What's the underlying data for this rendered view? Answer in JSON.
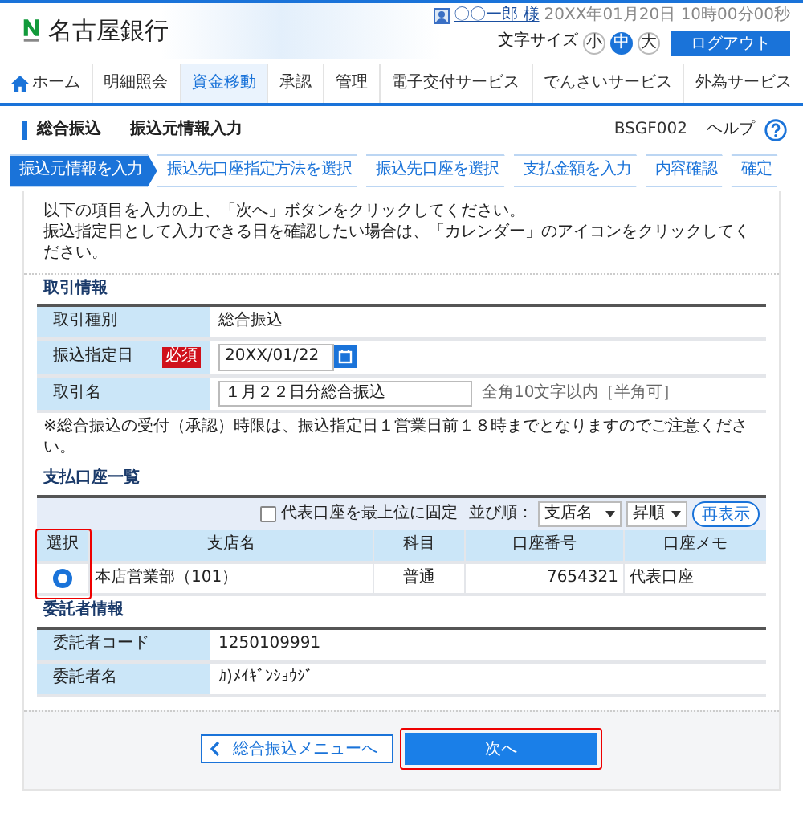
{
  "header": {
    "bank_name": "名古屋銀行",
    "user_name": "〇〇一郎 様",
    "datetime": "20XX年01月20日 10時00分00秒",
    "font_size_label": "文字サイズ",
    "font_sizes": [
      {
        "label": "小",
        "selected": false
      },
      {
        "label": "中",
        "selected": true
      },
      {
        "label": "大",
        "selected": false
      }
    ],
    "logout": "ログアウト"
  },
  "nav": [
    {
      "label": "ホーム",
      "kind": "home",
      "selected": false
    },
    {
      "label": "明細照会",
      "kind": "text",
      "selected": false
    },
    {
      "label": "資金移動",
      "kind": "text",
      "selected": true
    },
    {
      "label": "承認",
      "kind": "text",
      "selected": false
    },
    {
      "label": "管理",
      "kind": "text",
      "selected": false
    },
    {
      "label": "電子交付サービス",
      "kind": "text",
      "selected": false
    },
    {
      "label": "でんさいサービス",
      "kind": "text",
      "selected": false
    },
    {
      "label": "外為サービス",
      "kind": "text",
      "selected": false
    }
  ],
  "page": {
    "category": "総合振込",
    "title": "振込元情報入力",
    "screen_id": "BSGF002",
    "help": "ヘルプ"
  },
  "steps": [
    {
      "label": "振込元情報を入力",
      "selected": true
    },
    {
      "label": "振込先口座指定方法を選択",
      "selected": false
    },
    {
      "label": "振込先口座を選択",
      "selected": false
    },
    {
      "label": "支払金額を入力",
      "selected": false
    },
    {
      "label": "内容確認",
      "selected": false
    },
    {
      "label": "確定",
      "selected": false
    }
  ],
  "instructions": [
    "以下の項目を入力の上、「次へ」ボタンをクリックしてください。",
    "振込指定日として入力できる日を確認したい場合は、「カレンダー」のアイコンをクリックしてください。"
  ],
  "transaction": {
    "title": "取引情報",
    "rows": [
      {
        "label": "取引種別",
        "kind": "text",
        "value": "総合振込"
      },
      {
        "label": "振込指定日",
        "kind": "date",
        "required": "必須",
        "value": "20XX/01/22"
      },
      {
        "label": "取引名",
        "kind": "input",
        "value": "１月２２日分総合振込",
        "hint": "全角10文字以内［半角可］"
      }
    ],
    "note": "※総合振込の受付（承認）時限は、振込指定日１営業日前１８時までとなりますのでご注意ください。"
  },
  "accounts": {
    "title": "支払口座一覧",
    "pin_label": "代表口座を最上位に固定",
    "pin_checked": false,
    "sort_label": "並び順：",
    "sort_field": "支店名",
    "sort_order": "昇順",
    "refresh": "再表示",
    "select_highlighted": true,
    "columns": [
      "選択",
      "支店名",
      "科目",
      "口座番号",
      "口座メモ"
    ],
    "rows": [
      {
        "selected": true,
        "branch": "本店営業部（101）",
        "type": "普通",
        "number": "7654321",
        "memo": "代表口座"
      }
    ]
  },
  "consignor": {
    "title": "委託者情報",
    "rows": [
      {
        "label": "委託者コード",
        "value": "1250109991"
      },
      {
        "label": "委託者名",
        "value": "ｶ)ﾒｲｷﾞﾝｼｮｳｼﾞ"
      }
    ]
  },
  "buttons": {
    "back": "総合振込メニューへ",
    "next": "次へ",
    "next_highlighted": true
  }
}
